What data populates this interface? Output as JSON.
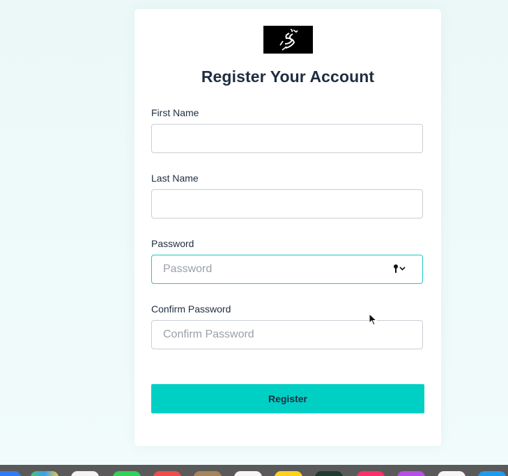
{
  "form": {
    "title": "Register Your Account",
    "first_name_label": "First Name",
    "first_name_value": "",
    "last_name_label": "Last Name",
    "last_name_value": "",
    "password_label": "Password",
    "password_placeholder": "Password",
    "confirm_password_label": "Confirm Password",
    "confirm_password_placeholder": "Confirm Password",
    "register_label": "Register"
  },
  "colors": {
    "accent": "#00cfc4",
    "focus_border": "#1ec9c2",
    "text": "#1f2d40",
    "background": "#eef9f9"
  },
  "icons": {
    "logo": "runner-logo",
    "password_manager": "key-icon",
    "cursor": "mouse-pointer-icon"
  },
  "dock": {
    "icons": [
      "app-icon-blue",
      "maps-icon",
      "photos-icon",
      "messages-icon",
      "calendar-icon",
      "app-icon-brown",
      "app-icon-white",
      "notes-icon",
      "app-icon-dark",
      "music-icon",
      "podcasts-icon",
      "app-icon-light",
      "app-store-icon"
    ]
  }
}
